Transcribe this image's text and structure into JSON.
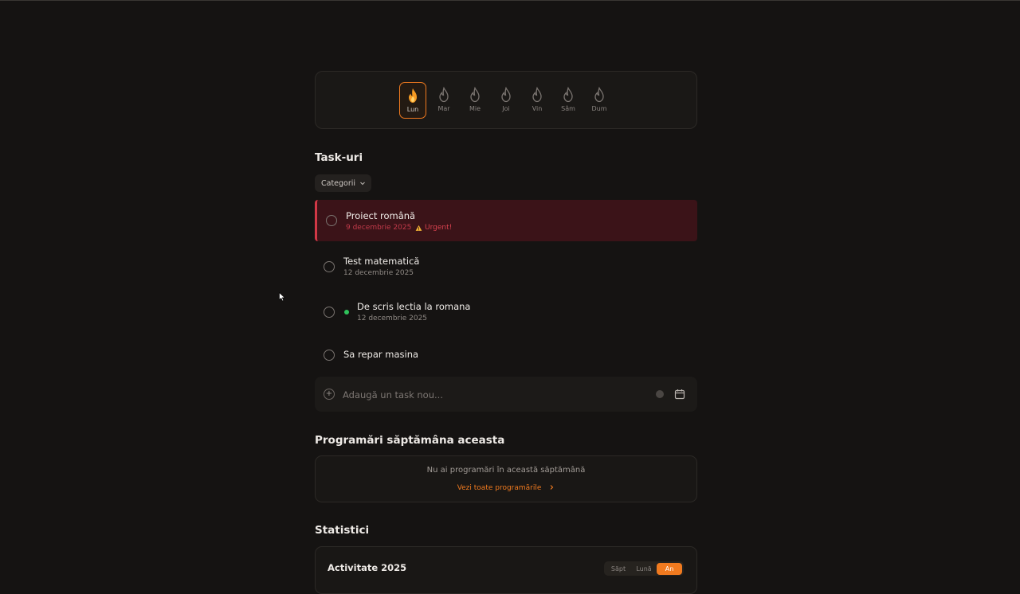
{
  "streak": {
    "days": [
      {
        "label": "Lun",
        "active": true
      },
      {
        "label": "Mar",
        "active": false
      },
      {
        "label": "Mie",
        "active": false
      },
      {
        "label": "Joi",
        "active": false
      },
      {
        "label": "Vin",
        "active": false
      },
      {
        "label": "Sâm",
        "active": false
      },
      {
        "label": "Dum",
        "active": false
      }
    ]
  },
  "tasks_section": {
    "title": "Task-uri",
    "category_filter": "Categorii",
    "tasks": [
      {
        "title": "Proiect română",
        "date": "9 decembrie 2025",
        "urgent_label": "Urgent!",
        "urgent": true
      },
      {
        "title": "Test matematică",
        "date": "12 decembrie 2025"
      },
      {
        "title": "De scris lectia la romana",
        "date": "12 decembrie 2025",
        "status_color": "#2fc25b"
      },
      {
        "title": "Sa repar masina"
      }
    ],
    "add_placeholder": "Adaugă un task nou..."
  },
  "appointments": {
    "title": "Programări săptămâna aceasta",
    "empty_text": "Nu ai programări în această săptămână",
    "see_all": "Vezi toate programările"
  },
  "stats": {
    "title": "Statistici",
    "card_title": "Activitate 2025",
    "periods": [
      "Săpt",
      "Lună",
      "An"
    ],
    "active_period": "An"
  },
  "colors": {
    "accent": "#f07a1f",
    "urgent": "#d23846",
    "background": "#151312"
  }
}
